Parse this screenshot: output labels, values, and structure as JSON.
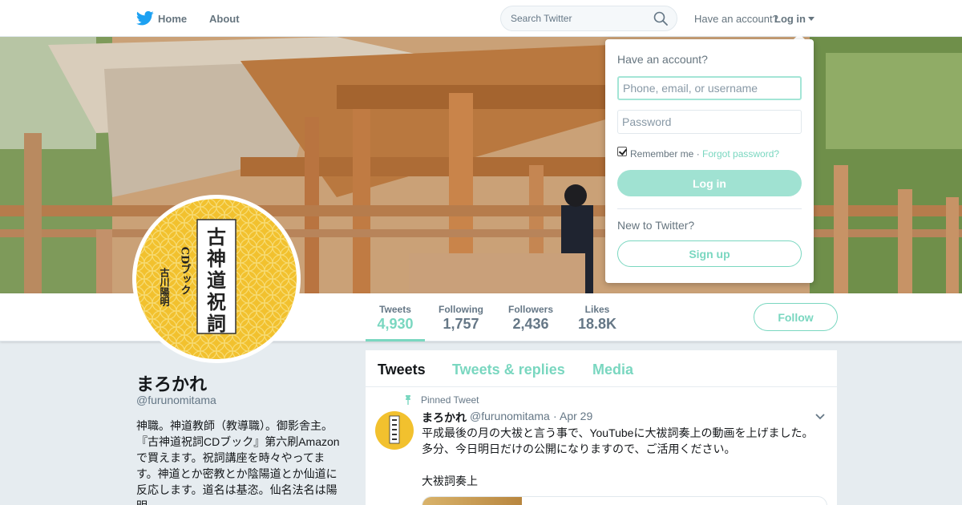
{
  "nav": {
    "home_label": "Home",
    "about_label": "About",
    "search_placeholder": "Search Twitter",
    "have_account": "Have an account?",
    "login_label": "Log in"
  },
  "profile": {
    "display_name": "まろかれ",
    "screen_name": "@furunomitama",
    "bio": "神職。神道教師（教導職）。御影舎主。『古神道祝詞CDブック』第六刷Amazonで買えます。祝詞講座を時々やってます。神道とか密教とか陰陽道とか仙道に反応します。道名は基恣。仙名法名は陽明。",
    "avatar_text": {
      "title": "古神道祝詞",
      "subtitle": "CDブック",
      "author": "古川陽明"
    }
  },
  "stats": [
    {
      "label": "Tweets",
      "value": "4,930",
      "active": true
    },
    {
      "label": "Following",
      "value": "1,757",
      "active": false
    },
    {
      "label": "Followers",
      "value": "2,436",
      "active": false
    },
    {
      "label": "Likes",
      "value": "18.8K",
      "active": false
    }
  ],
  "follow_label": "Follow",
  "timeline": {
    "tabs": [
      "Tweets",
      "Tweets & replies",
      "Media"
    ],
    "pinned_label": "Pinned Tweet",
    "tweet": {
      "name": "まろかれ",
      "handle": "@furunomitama",
      "separator": "·",
      "date": "Apr 29",
      "text": "平成最後の月の大祓と言う事で、YouTubeに大祓詞奏上の動画を上げました。多分、今日明日だけの公開になりますので、ご活用ください。",
      "text2": "大祓詞奏上"
    }
  },
  "login_dropdown": {
    "title": "Have an account?",
    "username_placeholder": "Phone, email, or username",
    "password_placeholder": "Password",
    "remember_label": "Remember me ·",
    "forgot_label": "Forgot password?",
    "login_button": "Log in",
    "new_label": "New to Twitter?",
    "signup_button": "Sign up"
  },
  "colors": {
    "accent": "#7ad7c0",
    "login_button_bg": "#a0e2d2",
    "twitter_blue": "#1da1f2",
    "avatar_yellow": "#f2c12e"
  },
  "icons": [
    "twitter-bird-icon",
    "search-icon",
    "caret-down-icon",
    "pin-icon",
    "chevron-down-icon"
  ]
}
